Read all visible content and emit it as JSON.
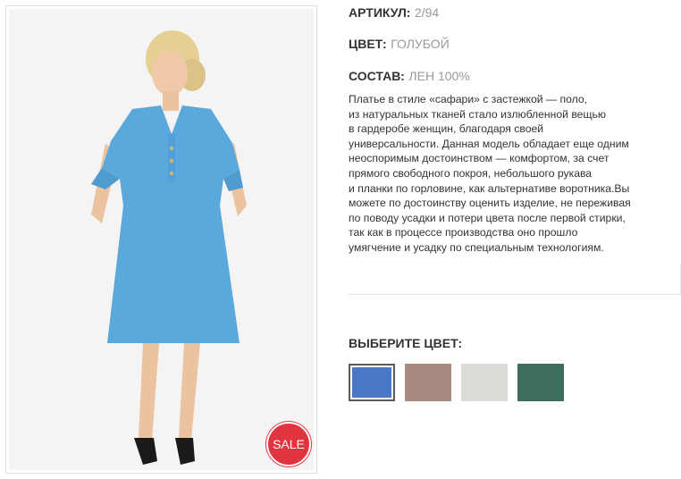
{
  "product": {
    "article_label": "АРТИКУЛ:",
    "article_value": "2/94",
    "color_label": "ЦВЕТ:",
    "color_value": "ГОЛУБОЙ",
    "composition_label": "СОСТАВ:",
    "composition_value": "ЛЕН 100%",
    "description_lines": [
      "Платье в стиле «сафари» с застежкой — поло,",
      "из натуральных тканей стало излюбленной вещью",
      "в гардеробе женщин, благодаря своей",
      "универсальности. Данная модель обладает еще одним",
      "неоспоримым достоинством — комфортом, за счет",
      "прямого свободного покроя, небольшого рукава",
      "и планки по горловине, как альтернативе воротника.Вы",
      "можете по достоинству оценить изделие, не переживая",
      "по поводу усадки и потери цвета после первой стирки,",
      "так как в процессе производства оно прошло",
      "умягчение и усадку по специальным технологиям."
    ]
  },
  "badge": {
    "sale": "SALE"
  },
  "color_picker": {
    "title": "ВЫБЕРИТЕ ЦВЕТ:",
    "swatches": [
      {
        "color": "#4a78c8",
        "selected": true
      },
      {
        "color": "#a88a82",
        "selected": false
      },
      {
        "color": "#dcdcd6",
        "selected": false
      },
      {
        "color": "#3d6d5c",
        "selected": false
      }
    ]
  },
  "colors": {
    "sale_red": "#e0353f",
    "dress_blue": "#5aa8dc"
  }
}
